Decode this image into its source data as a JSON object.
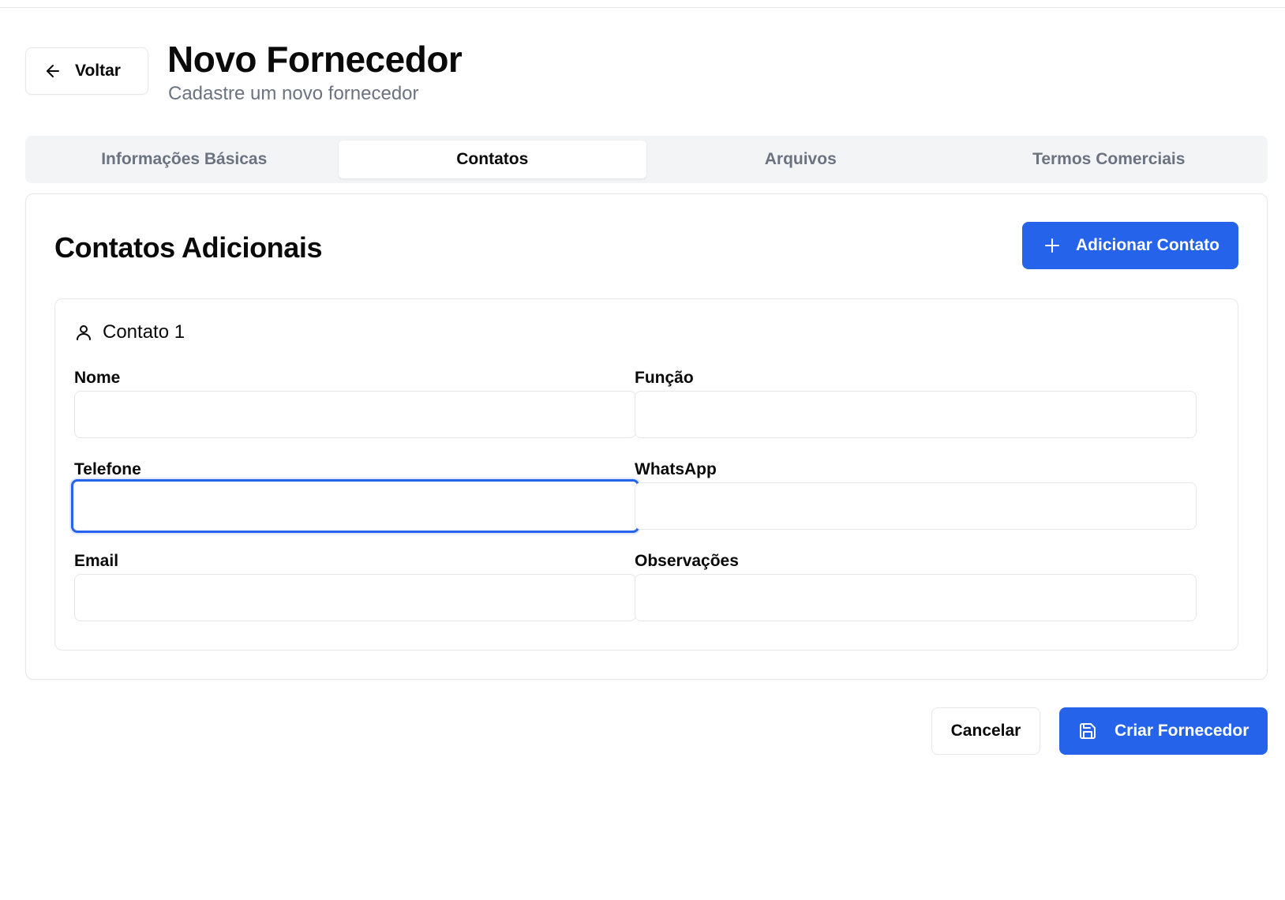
{
  "header": {
    "back_label": "Voltar",
    "title": "Novo Fornecedor",
    "subtitle": "Cadastre um novo fornecedor"
  },
  "tabs": [
    {
      "label": "Informações Básicas",
      "active": false
    },
    {
      "label": "Contatos",
      "active": true
    },
    {
      "label": "Arquivos",
      "active": false
    },
    {
      "label": "Termos Comerciais",
      "active": false
    }
  ],
  "card": {
    "title": "Contatos Adicionais",
    "add_button_label": "Adicionar Contato",
    "contact": {
      "heading": "Contato 1",
      "fields": {
        "nome": {
          "label": "Nome",
          "value": ""
        },
        "funcao": {
          "label": "Função",
          "value": ""
        },
        "telefone": {
          "label": "Telefone",
          "value": ""
        },
        "whatsapp": {
          "label": "WhatsApp",
          "value": ""
        },
        "email": {
          "label": "Email",
          "value": ""
        },
        "observacoes": {
          "label": "Observações",
          "value": ""
        }
      }
    }
  },
  "footer": {
    "cancel_label": "Cancelar",
    "create_label": "Criar Fornecedor"
  },
  "colors": {
    "accent": "#2563eb",
    "muted_text": "#6b7280",
    "border": "#e5e7eb",
    "tab_bg": "#f3f4f6"
  },
  "icons": {
    "back": "arrow-left-icon",
    "add": "plus-icon",
    "contact": "user-icon",
    "save": "save-icon"
  }
}
